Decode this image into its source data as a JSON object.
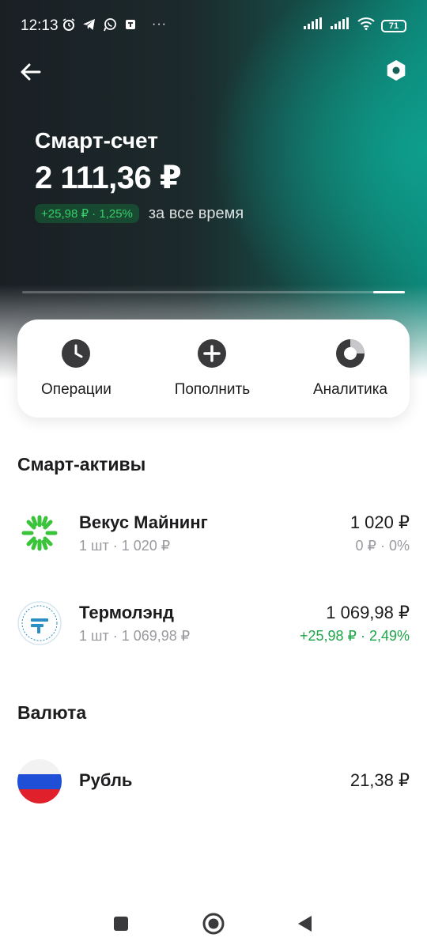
{
  "status_bar": {
    "time": "12:13",
    "icons": [
      "alarm-icon",
      "telegram-icon",
      "whatsapp-icon",
      "shield-icon"
    ],
    "more": "···",
    "battery": "71"
  },
  "header": {
    "title": "Смарт-счет",
    "balance": "2 111,36 ₽",
    "change": "+25,98 ₽ · 1,25%",
    "change_caption": "за все время",
    "change_color": "#36d06a"
  },
  "actions": [
    {
      "label": "Операции",
      "icon": "clock-icon"
    },
    {
      "label": "Пополнить",
      "icon": "plus-icon"
    },
    {
      "label": "Аналитика",
      "icon": "pie-chart-icon"
    }
  ],
  "sections": {
    "smart_assets_title": "Смарт-активы",
    "currency_title": "Валюта"
  },
  "assets": [
    {
      "name": "Векус Майнинг",
      "sub": "1 шт · 1 020 ₽",
      "value": "1 020 ₽",
      "change": "0 ₽ · 0%",
      "logo": "vekus-logo"
    },
    {
      "name": "Термолэнд",
      "sub": "1 шт · 1 069,98 ₽",
      "value": "1 069,98 ₽",
      "change": "+25,98 ₽ · 2,49%",
      "logo": "termoland-logo"
    }
  ],
  "currency": [
    {
      "name": "Рубль",
      "value": "21,38 ₽",
      "logo": "russia-flag-icon"
    }
  ],
  "colors": {
    "positive": "#1fa54a",
    "muted": "#9a9aa0",
    "accent_teal": "#0e9e8c"
  }
}
